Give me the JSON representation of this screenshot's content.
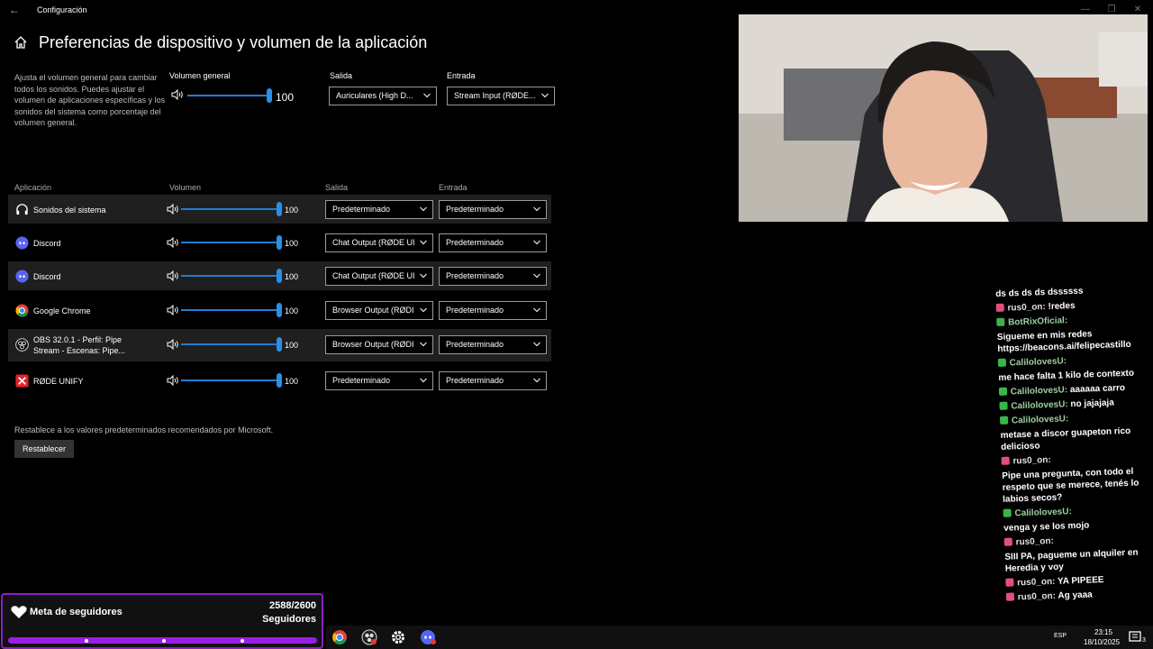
{
  "window": {
    "title": "Configuración"
  },
  "page": {
    "title": "Preferencias de dispositivo y volumen de la aplicación",
    "description": "Ajusta el volumen general para cambiar todos los sonidos. Puedes ajustar el volumen de aplicaciones específicas y los sonidos del sistema como porcentaje del volumen general."
  },
  "master": {
    "label": "Volumen general",
    "value": "100",
    "level": 1.0,
    "output_label": "Salida",
    "output_value": "Auriculares (High D...",
    "input_label": "Entrada",
    "input_value": "Stream Input (RØDE..."
  },
  "table": {
    "headers": {
      "app": "Aplicación",
      "volume": "Volumen",
      "output": "Salida",
      "input": "Entrada"
    },
    "rows": [
      {
        "name": "Sonidos del sistema",
        "icon": "headphones-icon",
        "volume": "100",
        "level": 1.0,
        "output": "Predeterminado",
        "input": "Predeterminado"
      },
      {
        "name": "Discord",
        "icon": "discord-icon",
        "volume": "100",
        "level": 1.0,
        "output": "Chat Output (RØDE UI",
        "input": "Predeterminado"
      },
      {
        "name": "Discord",
        "icon": "discord-icon",
        "volume": "100",
        "level": 1.0,
        "output": "Chat Output (RØDE UI",
        "input": "Predeterminado"
      },
      {
        "name": "Google Chrome",
        "icon": "chrome-icon",
        "volume": "100",
        "level": 1.0,
        "output": "Browser Output (RØDI",
        "input": "Predeterminado"
      },
      {
        "name": "OBS 32.0.1 - Perfil: Pipe Stream - Escenas: Pipe...",
        "icon": "obs-icon",
        "volume": "100",
        "level": 1.0,
        "output": "Browser Output (RØDI",
        "input": "Predeterminado"
      },
      {
        "name": "RØDE UNIFY",
        "icon": "rode-unify-icon",
        "volume": "100",
        "level": 1.0,
        "output": "Predeterminado",
        "input": "Predeterminado"
      }
    ]
  },
  "reset": {
    "text": "Restablece a los valores predeterminados recomendados por Microsoft.",
    "button": "Restablecer"
  },
  "chat": {
    "messages": [
      {
        "user": "",
        "text": "ds ds ds ds dssssss"
      },
      {
        "user": "rus0_on:",
        "text": "!redes"
      },
      {
        "user": "BotRixOficial:",
        "text": ""
      },
      {
        "user": "",
        "text": "Sigueme en mis redes https://beacons.ai/felipecastillo"
      },
      {
        "user": "CalilolovesU:",
        "text": ""
      },
      {
        "user": "",
        "text": "me hace falta 1 kilo de contexto"
      },
      {
        "user": "CalilolovesU:",
        "text": "aaaaaa carro"
      },
      {
        "user": "CalilolovesU:",
        "text": "no jajajaja"
      },
      {
        "user": "CalilolovesU:",
        "text": ""
      },
      {
        "user": "",
        "text": "metase a discor guapeton rico delicioso"
      },
      {
        "user": "rus0_on:",
        "text": ""
      },
      {
        "user": "",
        "text": "Pipe una pregunta, con todo el respeto que se merece, tenés lo labios secos?"
      },
      {
        "user": "CalilolovesU:",
        "text": ""
      },
      {
        "user": "",
        "text": "venga y se los mojo"
      },
      {
        "user": "rus0_on:",
        "text": ""
      },
      {
        "user": "",
        "text": "SIII PA, pagueme un alquiler en Heredia y voy"
      },
      {
        "user": "rus0_on:",
        "text": "YA PIPEEE"
      },
      {
        "user": "rus0_on:",
        "text": "Ag yaaa"
      }
    ]
  },
  "goal": {
    "title": "Meta de seguidores",
    "current": "2588",
    "target": "/2600",
    "unit": "Seguidores",
    "progress": 0.995
  },
  "tray": {
    "lang": "ESP",
    "time": "23:15",
    "date": "18/10/2025",
    "notif_count": "3"
  },
  "colors": {
    "accent": "#2a8ee6",
    "goal_purple": "#9b1ee6"
  }
}
